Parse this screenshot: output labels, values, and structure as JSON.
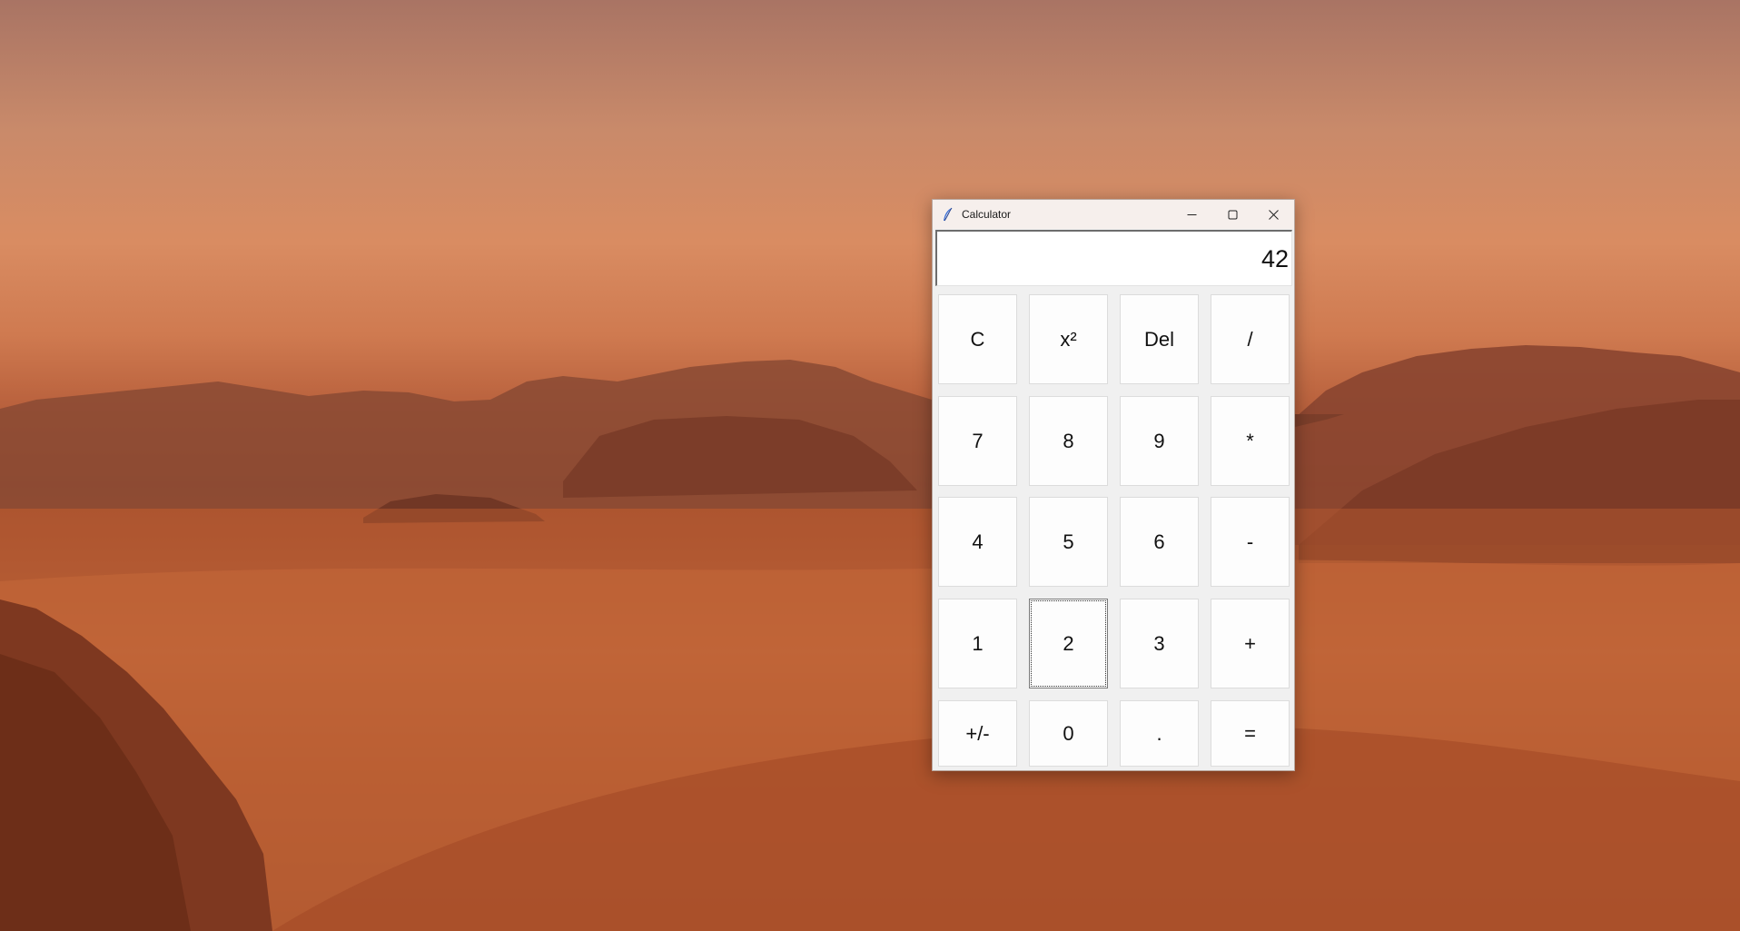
{
  "window": {
    "title": "Calculator"
  },
  "display": {
    "value": "42"
  },
  "keys": [
    "C",
    "x²",
    "Del",
    "/",
    "7",
    "8",
    "9",
    "*",
    "4",
    "5",
    "6",
    "-",
    "1",
    "2",
    "3",
    "+",
    "+/-",
    "0",
    ".",
    "="
  ],
  "focused_key": "2",
  "icons": {
    "app": "feather-icon",
    "minimize": "minimize-icon",
    "maximize": "maximize-icon",
    "close": "close-icon"
  },
  "colors": {
    "titlebar": "#f6efec",
    "window_bg": "#f0f0f0",
    "key_bg": "#fdfdfd",
    "display_bg": "#ffffff"
  }
}
